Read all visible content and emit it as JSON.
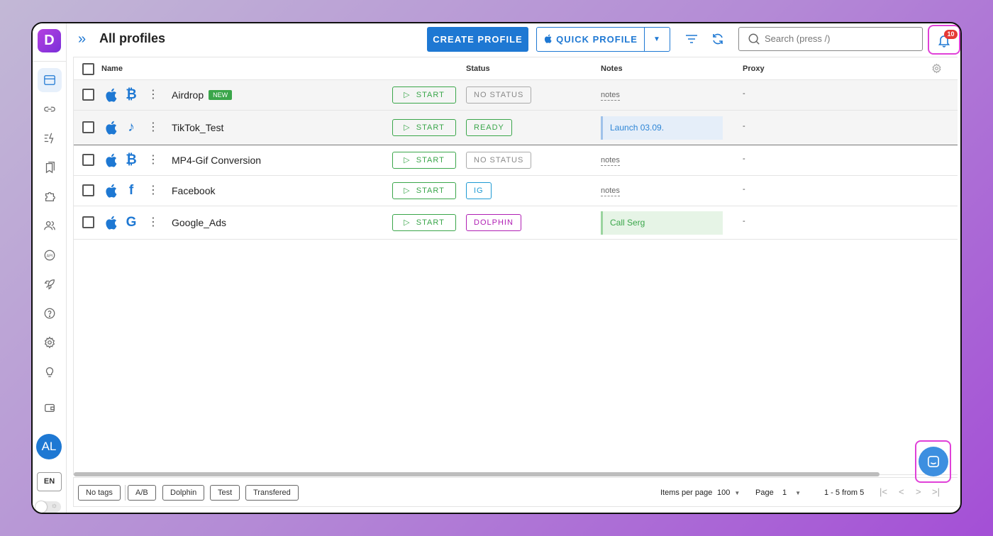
{
  "app": {
    "logo_letter": "D",
    "title": "All profiles"
  },
  "header": {
    "create_label": "CREATE PROFILE",
    "quick_label": "QUICK PROFILE",
    "search_placeholder": "Search (press /)",
    "notifications_count": "10"
  },
  "sidebar": {
    "items": [
      "profiles",
      "links",
      "automation",
      "bookmarks",
      "extensions",
      "users",
      "api",
      "launch",
      "help",
      "settings",
      "ideas",
      "wallet"
    ],
    "avatar_initials": "AL",
    "language": "EN"
  },
  "table": {
    "columns": {
      "name": "Name",
      "status": "Status",
      "notes": "Notes",
      "proxy": "Proxy"
    },
    "rows": [
      {
        "name": "Airdrop",
        "badge": "NEW",
        "os": "apple",
        "site": "bitcoin",
        "site_glyph": "₿",
        "start": "START",
        "status": "NO STATUS",
        "status_kind": "none",
        "note": "notes",
        "note_kind": "link",
        "proxy": "-"
      },
      {
        "name": "TikTok_Test",
        "badge": "",
        "os": "apple",
        "site": "tiktok",
        "site_glyph": "♪",
        "start": "START",
        "status": "READY",
        "status_kind": "ready",
        "note": "Launch 03.09.",
        "note_kind": "blue",
        "proxy": "-"
      },
      {
        "name": "MP4-Gif Conversion",
        "badge": "",
        "os": "apple",
        "site": "bitcoin",
        "site_glyph": "₿",
        "start": "START",
        "status": "NO STATUS",
        "status_kind": "none",
        "note": "notes",
        "note_kind": "link",
        "proxy": "-"
      },
      {
        "name": "Facebook",
        "badge": "",
        "os": "apple",
        "site": "facebook",
        "site_glyph": "f",
        "start": "START",
        "status": "IG",
        "status_kind": "ig",
        "note": "notes",
        "note_kind": "link",
        "proxy": "-"
      },
      {
        "name": "Google_Ads",
        "badge": "",
        "os": "apple",
        "site": "google",
        "site_glyph": "G",
        "start": "START",
        "status": "DOLPHIN",
        "status_kind": "dolphin",
        "note": "Call Serg",
        "note_kind": "green",
        "proxy": "-"
      }
    ]
  },
  "footer": {
    "tags": [
      "No tags",
      "A/B",
      "Dolphin",
      "Test",
      "Transfered"
    ],
    "items_per_page_label": "Items per page",
    "items_per_page": "100",
    "page_label": "Page",
    "page": "1",
    "range": "1 - 5 from 5"
  },
  "colors": {
    "accent": "#1e78d3",
    "success": "#3aa64a",
    "highlight": "#e040d8",
    "brand": "#9b3ae0"
  }
}
